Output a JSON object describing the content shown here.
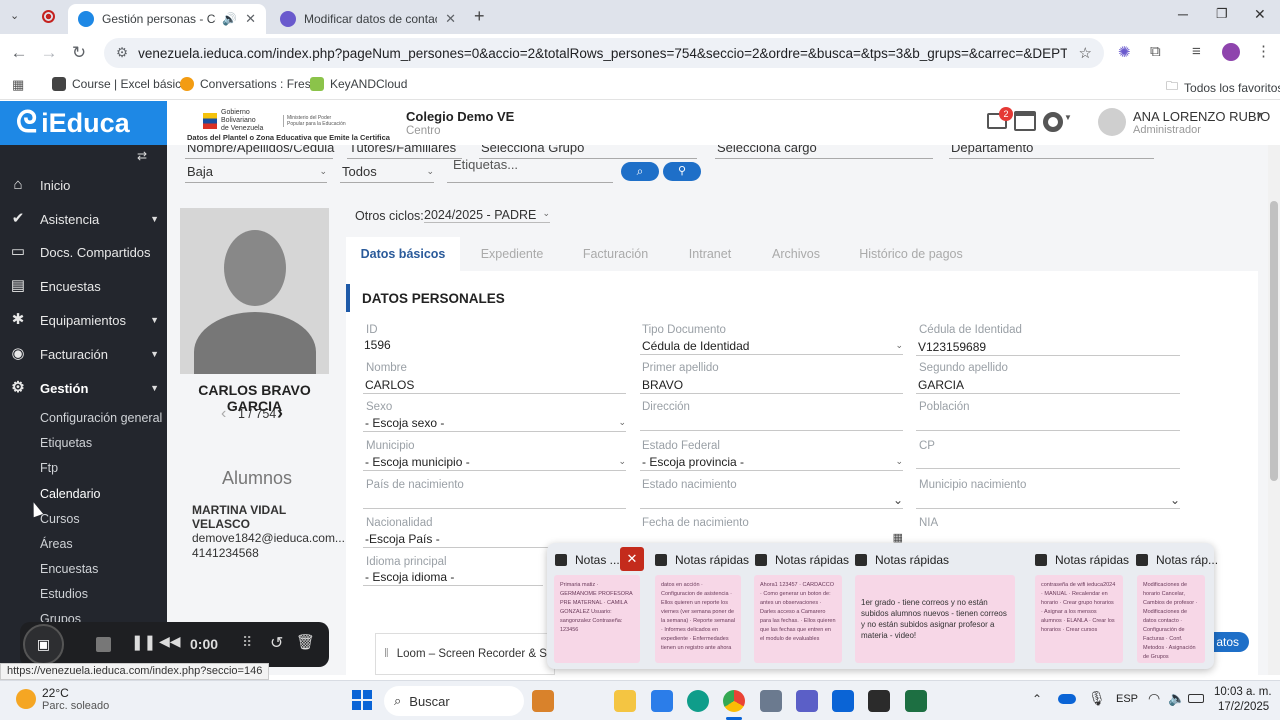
{
  "browser": {
    "tabs": [
      {
        "title": "Gestión personas - Colegio",
        "active": true
      },
      {
        "title": "Modificar datos de contacto y i",
        "active": false
      }
    ],
    "url": "venezuela.ieduca.com/index.php?pageNum_persones=0&accio=2&totalRows_persones=754&seccio=2&ordre=&busca=&tps=3&b_grups=&carrec=&DEPT=&BAIXA=&estat_m=...",
    "bookmarks": [
      "Course | Excel básic...",
      "Conversations : Fres...",
      "KeyANDCloud"
    ],
    "all_bookmarks": "Todos los favoritos",
    "status_url": "https://venezuela.ieduca.com/index.php?seccio=146"
  },
  "header": {
    "brand": "iEduca",
    "gov_line1": "Gobierno Bolivariano",
    "gov_line2": "de Venezuela",
    "gov_ministry": "Ministerio del Poder Popular para la Educación",
    "gov_caption": "Datos del Plantel o Zona Educativa que Emite la Certifica",
    "school_name": "Colegio Demo VE",
    "school_role": "Centro",
    "mail_badge": "2",
    "user_name": "ANA LORENZO RUBIO",
    "user_role": "Administrador"
  },
  "sidebar": {
    "items": [
      {
        "label": "Inicio",
        "icon": "home-icon"
      },
      {
        "label": "Asistencia",
        "icon": "check-circle-icon",
        "caret": true
      },
      {
        "label": "Docs. Compartidos",
        "icon": "folder-icon"
      },
      {
        "label": "Encuestas",
        "icon": "clipboard-icon"
      },
      {
        "label": "Equipamientos",
        "icon": "cog-icon",
        "caret": true
      },
      {
        "label": "Facturación",
        "icon": "database-icon",
        "caret": true
      },
      {
        "label": "Gestión",
        "icon": "gear-icon",
        "caret": true
      }
    ],
    "subitems": [
      "Configuración general",
      "Etiquetas",
      "Ftp",
      "Calendario",
      "Cursos",
      "Áreas",
      "Encuestas",
      "Estudios",
      "Grupos"
    ]
  },
  "filters": {
    "top_row": [
      "Nombre/Apellidos/Cédula",
      "Tutores/Familiares",
      "Selecciona Grupo",
      "Selecciona cargo",
      "Departamento"
    ],
    "baja": "Baja",
    "todos": "Todos",
    "etiquetas_placeholder": "Etiquetas..."
  },
  "person": {
    "full_name": "CARLOS BRAVO GARCIA",
    "pager": "1 / 754",
    "otros_ciclos_label": "Otros ciclos:",
    "ciclo": "2024/2025 - PADRE",
    "alumnos_title": "Alumnos",
    "alumno_name": "MARTINA VIDAL VELASCO",
    "alumno_email": "demove1842@ieduca.com...",
    "alumno_phone": "4141234568"
  },
  "detail_tabs": [
    "Datos básicos",
    "Expediente",
    "Facturación",
    "Intranet",
    "Archivos",
    "Histórico de pagos"
  ],
  "section_title": "DATOS PERSONALES",
  "fields": {
    "id": {
      "label": "ID",
      "value": "1596"
    },
    "tipo_doc": {
      "label": "Tipo Documento",
      "value": "Cédula de Identidad"
    },
    "cedula": {
      "label": "Cédula de Identidad",
      "value": "V123159689"
    },
    "nombre": {
      "label": "Nombre",
      "value": "CARLOS"
    },
    "primer_apellido": {
      "label": "Primer apellido",
      "value": "BRAVO"
    },
    "segundo_apellido": {
      "label": "Segundo apellido",
      "value": "GARCIA"
    },
    "sexo": {
      "label": "Sexo",
      "value": "- Escoja sexo -"
    },
    "direccion": {
      "label": "Dirección",
      "value": ""
    },
    "poblacion": {
      "label": "Población",
      "value": ""
    },
    "municipio": {
      "label": "Municipio",
      "value": "- Escoja municipio -"
    },
    "estado_federal": {
      "label": "Estado Federal",
      "value": "- Escoja provincia -"
    },
    "cp": {
      "label": "CP",
      "value": ""
    },
    "pais_nac": {
      "label": "País de nacimiento",
      "value": ""
    },
    "estado_nac": {
      "label": "Estado nacimiento",
      "value": ""
    },
    "municipio_nac": {
      "label": "Municipio nacimiento",
      "value": ""
    },
    "nacionalidad": {
      "label": "Nacionalidad",
      "value": "-Escoja País -"
    },
    "fecha_nac": {
      "label": "Fecha de nacimiento",
      "value": ""
    },
    "nia": {
      "label": "NIA",
      "value": ""
    },
    "idioma": {
      "label": "Idioma principal",
      "value": "- Escoja idioma -"
    }
  },
  "notes_popup": {
    "items": [
      {
        "title": "Notas ...",
        "text": "Primaria matiz · GERMANOME PROFESORA PRE MATERNAL · CAMILA GONZALEZ Usuario: sangonzalez Contraseña: 123456"
      },
      {
        "title": "Notas rápidas",
        "text": "datos en acción · Configuracion de asistencia · Ellos quieren un reporte los viernes (ver semana poner de la semana) · Reporte semanal · Informes delicados en expediente · Enfermedades tienen un registro ante ahora"
      },
      {
        "title": "Notas rápidas",
        "text": "Ahora1 123457 · CARDACCO · Como generar un boton de: antes un observaciones · Darles acceso a Camarero para las fechas. · Ellos quieren que las fechas que entren en el modulo de evaluables"
      },
      {
        "title": "Notas rápidas",
        "text": "1er grado - tiene correos y no están subidos alumnos nuevos - tienen correos y no están subidos asignar profesor a materia - video!"
      },
      {
        "title": "Notas rápidas",
        "text": "contraseña de wifi ieduca2024 · MANUAL · Recalendar en horario · Crear grupo horarios · Asignar a los mensos alumnos · ELANLA · Crear los horarios · Crear cursos"
      },
      {
        "title": "Notas ráp...",
        "text": "Modificaciones de horario Cancelar, Cambios de profesor · Modificaciones de datos contacto · Configuración de Facturas · Conf. Metodos · Asignación de Grupos"
      }
    ],
    "loom_label": "Loom – Screen Recorder & Screen",
    "partial_button": "atos"
  },
  "recorder": {
    "time": "0:00"
  },
  "taskbar": {
    "temp": "22°C",
    "weather": "Parc. soleado",
    "search": "Buscar",
    "lang": "ESP",
    "time": "10:03 a. m.",
    "date": "17/2/2025"
  }
}
